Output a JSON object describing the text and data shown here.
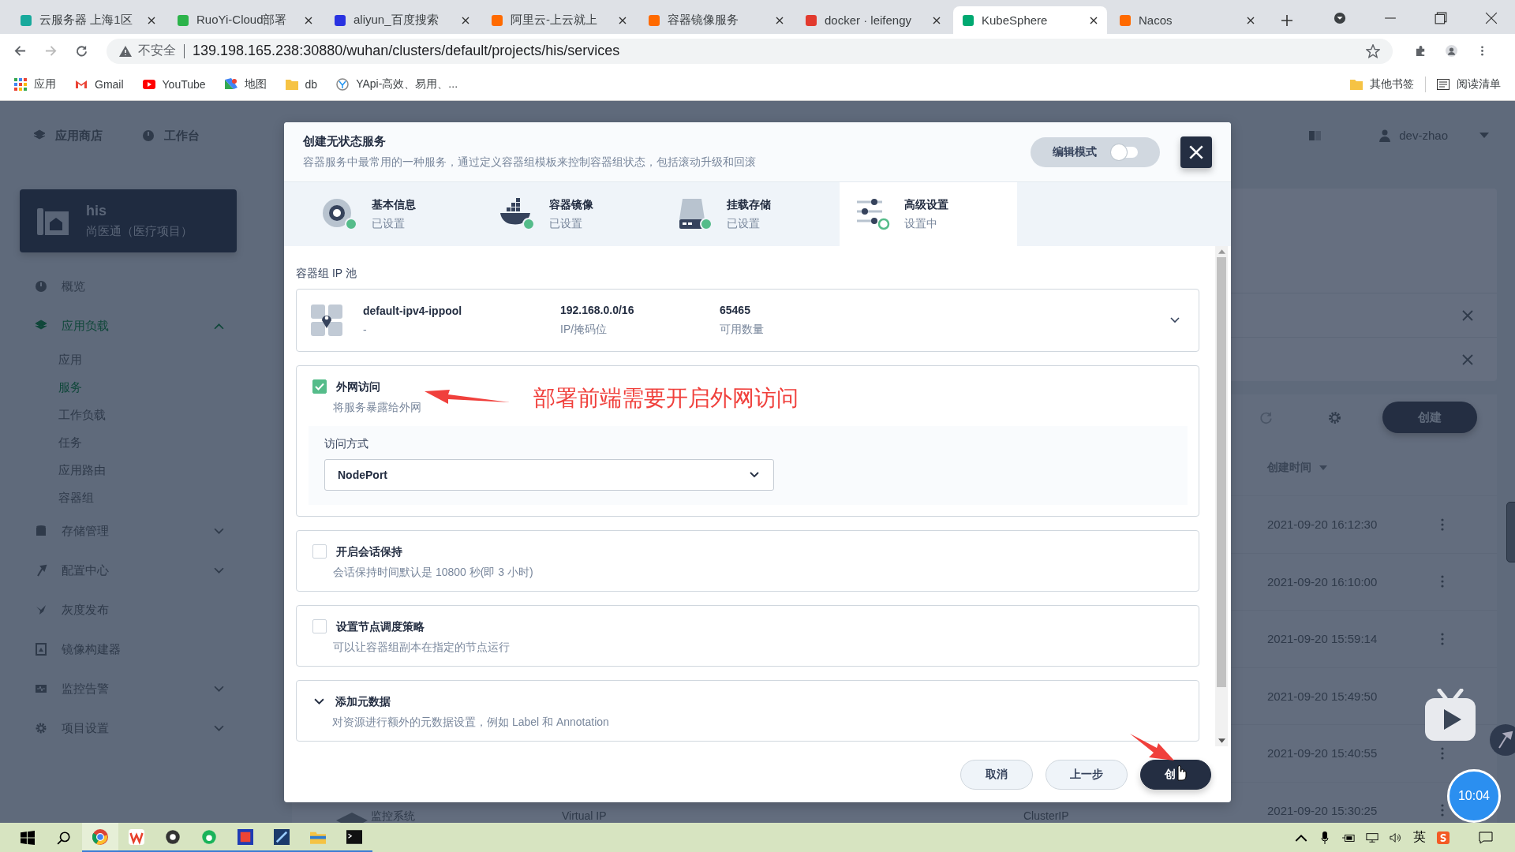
{
  "browser": {
    "tabs": [
      {
        "title": "云服务器 上海1区",
        "color": "#18a99c",
        "selected": false
      },
      {
        "title": "RuoYi-Cloud部署",
        "color": "#2cb34a",
        "selected": false
      },
      {
        "title": "aliyun_百度搜索",
        "color": "#2932e1",
        "selected": false
      },
      {
        "title": "阿里云-上云就上",
        "color": "#ff6a00",
        "selected": false
      },
      {
        "title": "容器镜像服务",
        "color": "#ff6a00",
        "selected": false
      },
      {
        "title": "docker · leifengy",
        "color": "#e23a2e",
        "selected": false
      },
      {
        "title": "KubeSphere",
        "color": "#00a971",
        "selected": true
      },
      {
        "title": "Nacos",
        "color": "#ff6a00",
        "selected": false
      }
    ],
    "address": {
      "warning": "不安全",
      "url": "139.198.165.238:30880/wuhan/clusters/default/projects/his/services"
    },
    "bookmarks": [
      {
        "label": "应用",
        "kind": "apps"
      },
      {
        "label": "Gmail",
        "kind": "gmail"
      },
      {
        "label": "YouTube",
        "kind": "youtube"
      },
      {
        "label": "地图",
        "kind": "maps"
      },
      {
        "label": "db",
        "kind": "folder"
      },
      {
        "label": "YApi-高效、易用、...",
        "kind": "yapi"
      }
    ],
    "other_bookmarks": "其他书签",
    "reading_list": "阅读清单"
  },
  "page": {
    "top_nav": [
      "应用商店",
      "工作台"
    ],
    "project": {
      "name": "his",
      "description": "尚医通（医疗项目）"
    },
    "nav": [
      {
        "label": "概览",
        "kind": "overview",
        "selected": false
      },
      {
        "label": "应用负载",
        "kind": "workload",
        "selected": true,
        "expanded": true,
        "children": [
          {
            "label": "应用",
            "selected": false
          },
          {
            "label": "服务",
            "selected": true
          },
          {
            "label": "工作负载",
            "selected": false
          },
          {
            "label": "任务",
            "selected": false
          },
          {
            "label": "应用路由",
            "selected": false
          },
          {
            "label": "容器组",
            "selected": false
          }
        ]
      },
      {
        "label": "存储管理",
        "kind": "storage",
        "selected": false,
        "expanded": false
      },
      {
        "label": "配置中心",
        "kind": "config",
        "selected": false,
        "expanded": false
      },
      {
        "label": "灰度发布",
        "kind": "grayscale",
        "selected": false
      },
      {
        "label": "镜像构建器",
        "kind": "builder",
        "selected": false
      },
      {
        "label": "监控告警",
        "kind": "monitor",
        "selected": false,
        "expanded": false
      },
      {
        "label": "项目设置",
        "kind": "settings",
        "selected": false,
        "expanded": false
      }
    ],
    "user": "dev-zhao",
    "create_button": "创建",
    "column": "创建时间",
    "rows": [
      {
        "time": "2021-09-20 16:12:30"
      },
      {
        "time": "2021-09-20 16:10:00"
      },
      {
        "time": "2021-09-20 15:59:14"
      },
      {
        "time": "2021-09-20 15:49:50"
      },
      {
        "time": "2021-09-20 15:40:55"
      },
      {
        "name": "监控系统",
        "ip": "Virtual IP",
        "type": "ClusterIP",
        "time": "2021-09-20 15:30:25"
      }
    ]
  },
  "modal": {
    "title": "创建无状态服务",
    "subtitle": "容器服务中最常用的一种服务，通过定义容器组模板来控制容器组状态，包括滚动升级和回滚",
    "edit_mode": {
      "label": "编辑模式",
      "on": false
    },
    "steps": [
      {
        "title": "基本信息",
        "status": "已设置",
        "kind": "info",
        "done": true,
        "selected": false
      },
      {
        "title": "容器镜像",
        "status": "已设置",
        "kind": "image",
        "done": true,
        "selected": false
      },
      {
        "title": "挂载存储",
        "status": "已设置",
        "kind": "storage",
        "done": true,
        "selected": false
      },
      {
        "title": "高级设置",
        "status": "设置中",
        "kind": "advanced",
        "done": false,
        "selected": true
      }
    ],
    "ip_pool_label": "容器组 IP 池",
    "ip_pool": {
      "name": "default-ipv4-ippool",
      "description": "-",
      "cidr": "192.168.0.0/16",
      "cidr_label": "IP/掩码位",
      "count": "65465",
      "count_label": "可用数量"
    },
    "options": [
      {
        "kind": "checkbox",
        "title": "外网访问",
        "description": "将服务暴露给外网",
        "checked": true,
        "access": {
          "label": "访问方式",
          "value": "NodePort"
        }
      },
      {
        "kind": "checkbox",
        "title": "开启会话保持",
        "description": "会话保持时间默认是 10800 秒(即 3 小时)",
        "checked": false
      },
      {
        "kind": "checkbox",
        "title": "设置节点调度策略",
        "description": "可以让容器组副本在指定的节点运行",
        "checked": false
      },
      {
        "kind": "expand",
        "title": "添加元数据",
        "description": "对资源进行额外的元数据设置，例如 Label 和 Annotation"
      }
    ],
    "buttons": [
      {
        "label": "取消",
        "kind": "secondary"
      },
      {
        "label": "上一步",
        "kind": "secondary"
      },
      {
        "label": "创",
        "kind": "primary"
      }
    ]
  },
  "annotation": "部署前端需要开启外网访问",
  "clock": "10:04",
  "taskbar": {
    "ime": "英"
  }
}
